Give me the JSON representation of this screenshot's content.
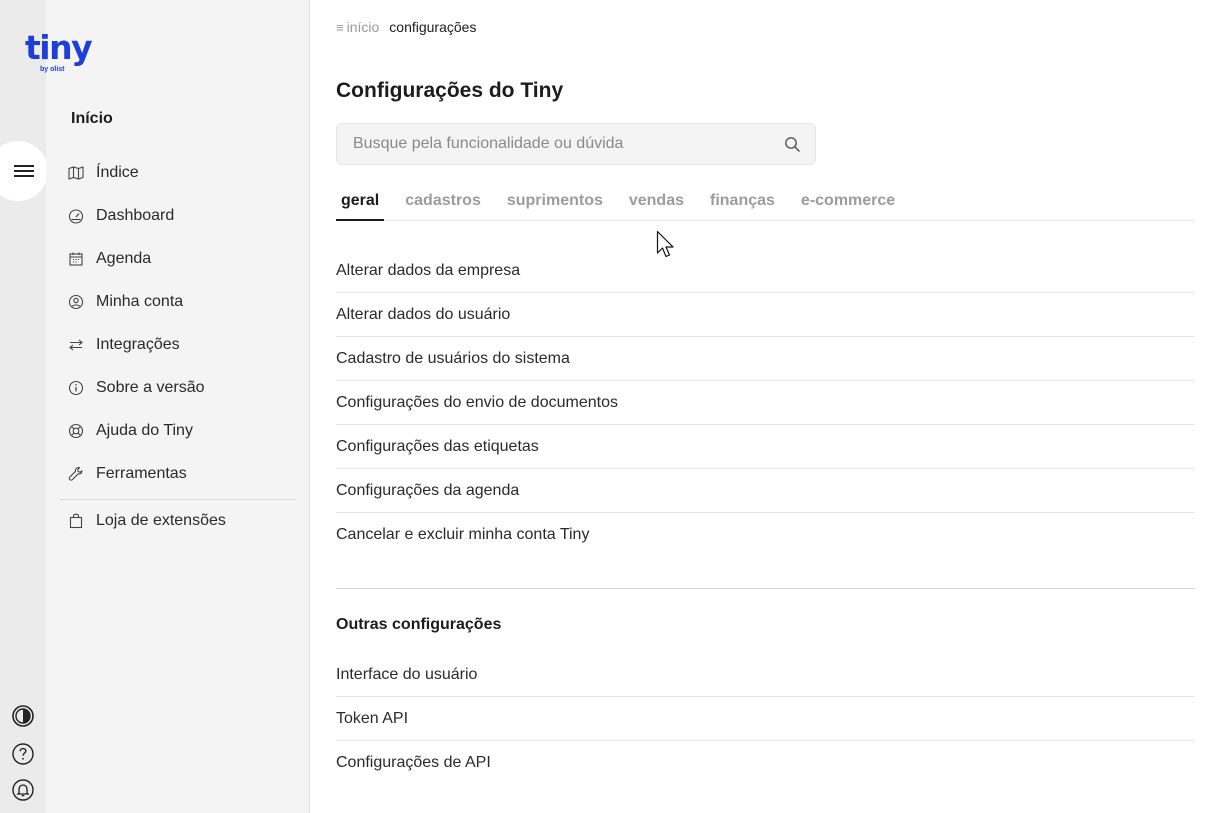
{
  "brand": {
    "name": "tiny",
    "tagline": "by olist",
    "color": "#1d3fd8"
  },
  "rail": {
    "menu_icon": "hamburger-icon",
    "bottom_icons": [
      "contrast-icon",
      "help-icon",
      "bell-icon"
    ]
  },
  "sidebar": {
    "heading": "Início",
    "items": [
      {
        "label": "Índice",
        "icon": "map-icon"
      },
      {
        "label": "Dashboard",
        "icon": "gauge-icon"
      },
      {
        "label": "Agenda",
        "icon": "calendar-icon"
      },
      {
        "label": "Minha conta",
        "icon": "user-circle-icon"
      },
      {
        "label": "Integrações",
        "icon": "arrows-icon"
      },
      {
        "label": "Sobre a versão",
        "icon": "info-icon"
      },
      {
        "label": "Ajuda do Tiny",
        "icon": "lifebuoy-icon"
      },
      {
        "label": "Ferramentas",
        "icon": "wrench-icon"
      }
    ],
    "store": {
      "label": "Loja de extensões",
      "icon": "bag-icon"
    }
  },
  "breadcrumb": {
    "home": "início",
    "current": "configurações"
  },
  "page": {
    "title": "Configurações do Tiny"
  },
  "search": {
    "placeholder": "Busque pela funcionalidade ou dúvida",
    "value": ""
  },
  "tabs": [
    {
      "label": "geral",
      "active": true
    },
    {
      "label": "cadastros",
      "active": false
    },
    {
      "label": "suprimentos",
      "active": false
    },
    {
      "label": "vendas",
      "active": false
    },
    {
      "label": "finanças",
      "active": false
    },
    {
      "label": "e-commerce",
      "active": false
    }
  ],
  "general_items": [
    "Alterar dados da empresa",
    "Alterar dados do usuário",
    "Cadastro de usuários do sistema",
    "Configurações do envio de documentos",
    "Configurações das etiquetas",
    "Configurações da agenda",
    "Cancelar e excluir minha conta Tiny"
  ],
  "other": {
    "title": "Outras configurações",
    "items": [
      "Interface do usuário",
      "Token API",
      "Configurações de API"
    ]
  }
}
